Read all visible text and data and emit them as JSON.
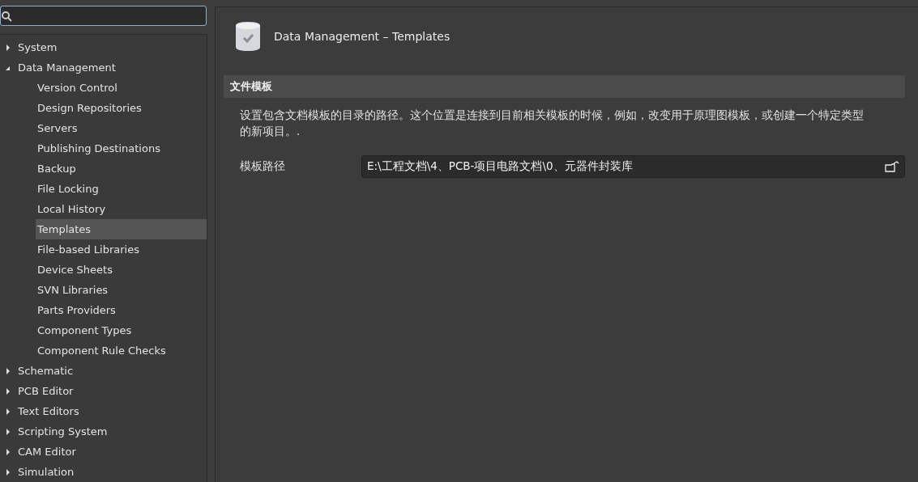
{
  "tree": [
    {
      "label": "System",
      "expanded": false,
      "selected": false
    },
    {
      "label": "Data Management",
      "expanded": true,
      "selected": false,
      "children": [
        {
          "label": "Version Control",
          "selected": false
        },
        {
          "label": "Design Repositories",
          "selected": false
        },
        {
          "label": "Servers",
          "selected": false
        },
        {
          "label": "Publishing Destinations",
          "selected": false
        },
        {
          "label": "Backup",
          "selected": false
        },
        {
          "label": "File Locking",
          "selected": false
        },
        {
          "label": "Local History",
          "selected": false
        },
        {
          "label": "Templates",
          "selected": true
        },
        {
          "label": "File-based Libraries",
          "selected": false
        },
        {
          "label": "Device Sheets",
          "selected": false
        },
        {
          "label": "SVN Libraries",
          "selected": false
        },
        {
          "label": "Parts Providers",
          "selected": false
        },
        {
          "label": "Component Types",
          "selected": false
        },
        {
          "label": "Component Rule Checks",
          "selected": false
        }
      ]
    },
    {
      "label": "Schematic",
      "expanded": false,
      "selected": false
    },
    {
      "label": "PCB Editor",
      "expanded": false,
      "selected": false
    },
    {
      "label": "Text Editors",
      "expanded": false,
      "selected": false
    },
    {
      "label": "Scripting System",
      "expanded": false,
      "selected": false
    },
    {
      "label": "CAM Editor",
      "expanded": false,
      "selected": false
    },
    {
      "label": "Simulation",
      "expanded": false,
      "selected": false
    }
  ],
  "page": {
    "title": "Data Management – Templates",
    "section": "文件模板",
    "description": "设置包含文档模板的目录的路径。这个位置是连接到目前相关模板的时候，例如，改变用于原理图模板，或创建一个特定类型的新项目。.",
    "path_label": "模板路径",
    "path_value": "E:\\工程文档\\4、PCB-项目电路文档\\0、元器件封装库"
  }
}
